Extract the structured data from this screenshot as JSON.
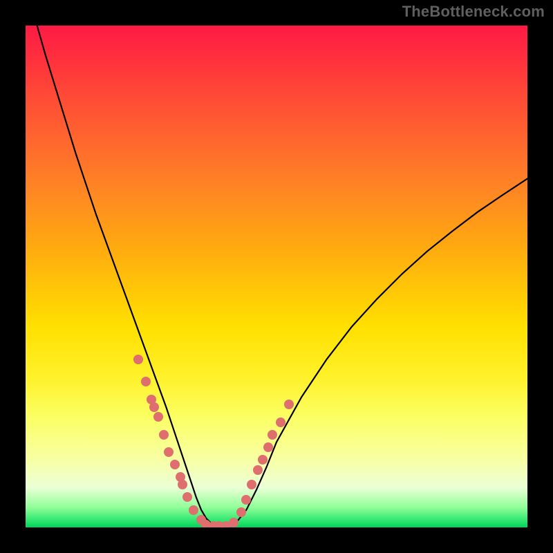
{
  "watermark": "TheBottleneck.com",
  "chart_data": {
    "type": "line",
    "title": "",
    "xlabel": "",
    "ylabel": "",
    "xlim": [
      0,
      100
    ],
    "ylim": [
      0,
      100
    ],
    "grid": false,
    "legend": false,
    "curve": {
      "x": [
        0,
        2,
        4,
        6,
        8,
        10,
        12,
        14,
        16,
        18,
        20,
        22,
        24,
        26,
        28,
        30,
        32,
        33,
        34,
        35,
        36,
        37,
        38,
        40,
        42,
        44,
        46,
        48,
        50,
        55,
        60,
        65,
        70,
        75,
        80,
        85,
        90,
        95,
        100
      ],
      "y": [
        108,
        101,
        94,
        87.5,
        81,
        74.5,
        68.5,
        62.5,
        57,
        51.5,
        46,
        40.5,
        35,
        29.5,
        24,
        18,
        12,
        9,
        6,
        3.5,
        1.8,
        0.8,
        0.3,
        0.2,
        1.0,
        3.5,
        7.5,
        12,
        17,
        26,
        33.5,
        40,
        45.5,
        50.5,
        55,
        59,
        62.8,
        66.2,
        69.5
      ]
    },
    "points": {
      "x": [
        22.5,
        24.0,
        25.0,
        25.6,
        26.5,
        27.5,
        28.5,
        29.8,
        30.8,
        31.2,
        32.3,
        33.5,
        35.0,
        36.0,
        37.5,
        38.5,
        40.0,
        41.5,
        43.0,
        44.0,
        45.0,
        46.3,
        47.2,
        48.3,
        49.2,
        50.8,
        52.5
      ],
      "y": [
        33.5,
        29.0,
        25.5,
        24.0,
        22.0,
        18.5,
        15.0,
        12.5,
        10.0,
        8.5,
        6.0,
        3.5,
        1.5,
        0.6,
        0.3,
        0.3,
        0.3,
        1.0,
        3.0,
        5.5,
        8.5,
        11.5,
        13.5,
        16.0,
        18.5,
        21.0,
        24.5
      ]
    },
    "colors": {
      "curve": "#000000",
      "points": "#df6e6e"
    }
  }
}
